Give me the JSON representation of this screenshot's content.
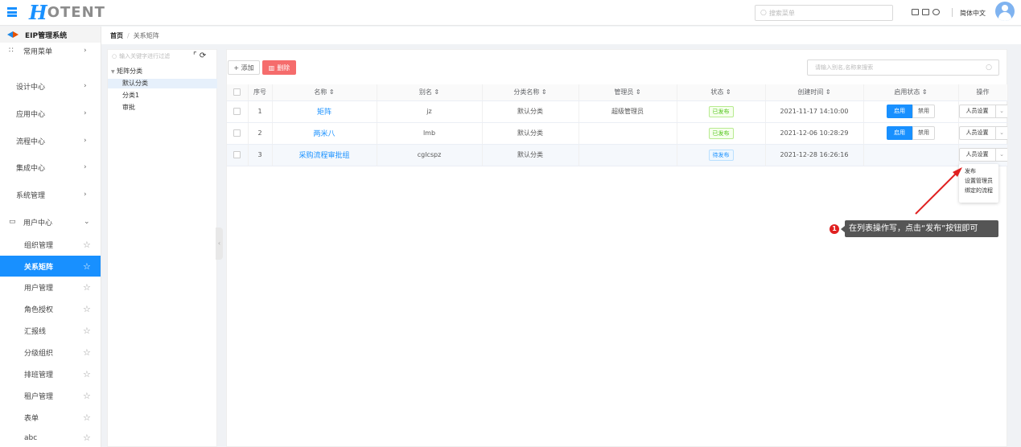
{
  "header": {
    "logo_h": "H",
    "logo_rest": "OTENT",
    "search_placeholder": "搜索菜单",
    "language": "简体中文"
  },
  "sidebar": {
    "system_title": "EIP管理系统",
    "items": [
      {
        "label": "常用菜单",
        "type": "group"
      },
      {
        "label": "设计中心",
        "type": "group"
      },
      {
        "label": "应用中心",
        "type": "group"
      },
      {
        "label": "流程中心",
        "type": "group"
      },
      {
        "label": "集成中心",
        "type": "group"
      },
      {
        "label": "系统管理",
        "type": "group"
      },
      {
        "label": "用户中心",
        "type": "group-open"
      },
      {
        "label": "组织管理",
        "type": "child"
      },
      {
        "label": "关系矩阵",
        "type": "child-active"
      },
      {
        "label": "用户管理",
        "type": "child"
      },
      {
        "label": "角色授权",
        "type": "child"
      },
      {
        "label": "汇报线",
        "type": "child"
      },
      {
        "label": "分级组织",
        "type": "child"
      },
      {
        "label": "排班管理",
        "type": "child"
      },
      {
        "label": "租户管理",
        "type": "child"
      },
      {
        "label": "表单",
        "type": "child"
      },
      {
        "label": "abc",
        "type": "child"
      }
    ]
  },
  "breadcrumb": {
    "home": "首页",
    "separator": "/",
    "current": "关系矩阵"
  },
  "tree": {
    "search_placeholder": "输入关键字进行过滤",
    "root": "矩阵分类",
    "children": [
      "默认分类",
      "分类1",
      "审批"
    ]
  },
  "toolbar": {
    "add_label": "+ 添加",
    "delete_label": "删除",
    "search_placeholder": "请输入别名,名称来搜索"
  },
  "table": {
    "headers": [
      "",
      "序号",
      "名称 ⇕",
      "别名 ⇕",
      "分类名称 ⇕",
      "管理员 ⇕",
      "状态 ⇕",
      "创建时间 ⇕",
      "启用状态 ⇕",
      "操作"
    ],
    "rows": [
      {
        "index": "1",
        "name": "矩阵",
        "alias": "jz",
        "category": "默认分类",
        "admin": "超级管理员",
        "status": "已发布",
        "status_type": "published",
        "created": "2021-11-17 14:10:00",
        "enable": true,
        "enable_on": "启用",
        "enable_off": "禁用",
        "op": "人员设置"
      },
      {
        "index": "2",
        "name": "两米八",
        "alias": "lmb",
        "category": "默认分类",
        "admin": "",
        "status": "已发布",
        "status_type": "published",
        "created": "2021-12-06 10:28:29",
        "enable": true,
        "enable_on": "启用",
        "enable_off": "禁用",
        "op": "人员设置"
      },
      {
        "index": "3",
        "name": "采购流程审批组",
        "alias": "cglcspz",
        "category": "默认分类",
        "admin": "",
        "status": "待发布",
        "status_type": "pending",
        "created": "2021-12-28 16:26:16",
        "enable": false,
        "enable_on": "",
        "enable_off": "",
        "op": "人员设置"
      }
    ]
  },
  "dropdown": {
    "items": [
      "发布",
      "设置管理员",
      "绑定的流程"
    ]
  },
  "annotation": {
    "badge": "1",
    "text": "在列表操作写，点击“发布”按钮即可"
  },
  "colors": {
    "primary": "#1890ff",
    "danger": "#f56c6c",
    "annotation_red": "#e02020"
  }
}
